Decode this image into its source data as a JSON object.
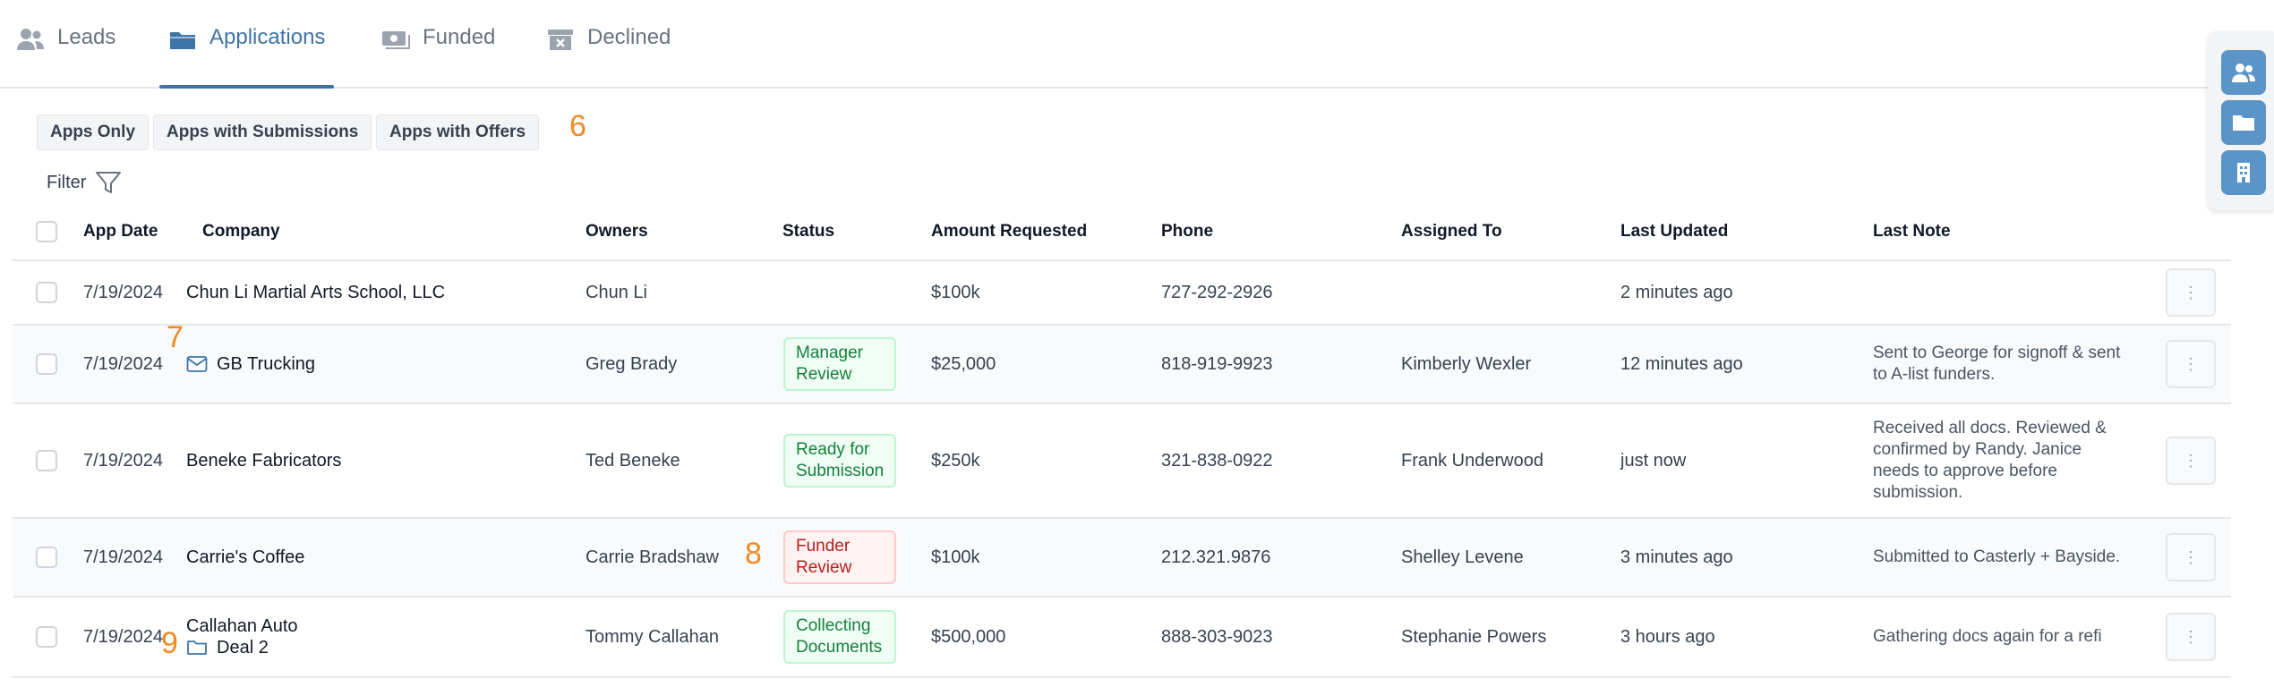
{
  "tabs": [
    {
      "label": "Leads",
      "icon": "users-icon"
    },
    {
      "label": "Applications",
      "icon": "folder-icon",
      "active": true
    },
    {
      "label": "Funded",
      "icon": "money-icon"
    },
    {
      "label": "Declined",
      "icon": "archive-x-icon"
    }
  ],
  "chips": [
    "Apps Only",
    "Apps with Submissions",
    "Apps with Offers"
  ],
  "markers": [
    "6",
    "7",
    "8",
    "9"
  ],
  "filter_label": "Filter",
  "columns": [
    "App Date",
    "Company",
    "Owners",
    "Status",
    "Amount Requested",
    "Phone",
    "Assigned To",
    "Last Updated",
    "Last Note"
  ],
  "rows": [
    {
      "date": "7/19/2024",
      "company": "Chun Li Martial Arts School, LLC",
      "owner": "Chun Li",
      "status": "",
      "amount": "$100k",
      "phone": "727-292-2926",
      "assigned": "",
      "updated": "2 minutes ago",
      "note": ""
    },
    {
      "date": "7/19/2024",
      "company": "GB Trucking",
      "company_icon": "envelope-icon",
      "owner": "Greg Brady",
      "status": "Manager Review",
      "amount": "$25,000",
      "phone": "818-919-9923",
      "assigned": "Kimberly Wexler",
      "updated": "12 minutes ago",
      "note": "Sent to George for signoff & sent to A-list funders."
    },
    {
      "date": "7/19/2024",
      "company": "Beneke Fabricators",
      "owner": "Ted Beneke",
      "status": "Ready for Submission",
      "amount": "$250k",
      "phone": "321-838-0922",
      "assigned": "Frank Underwood",
      "updated": "just now",
      "note": "Received all docs. Reviewed & confirmed by Randy. Janice needs to approve before submission."
    },
    {
      "date": "7/19/2024",
      "company": "Carrie's Coffee",
      "owner": "Carrie Bradshaw",
      "status": "Funder Review",
      "amount": "$100k",
      "phone": "212.321.9876",
      "assigned": "Shelley Levene",
      "updated": "3 minutes ago",
      "note": "Submitted to Casterly + Bayside."
    },
    {
      "date": "7/19/2024",
      "company": "Callahan Auto",
      "company_sub": "Deal 2",
      "company_icon": "folder-icon",
      "owner": "Tommy Callahan",
      "status": "Collecting Documents",
      "amount": "$500,000",
      "phone": "888-303-9023",
      "assigned": "Stephanie Powers",
      "updated": "3 hours ago",
      "note": "Gathering docs again for a refi"
    }
  ],
  "side_panel": [
    "users-icon",
    "folder-icon",
    "building-icon"
  ],
  "colors": {
    "accent": "#3d74a8",
    "marker": "#f08a24",
    "green_badge": "#15803d",
    "red_badge": "#b91c1c",
    "side_button": "#5b95c7"
  }
}
